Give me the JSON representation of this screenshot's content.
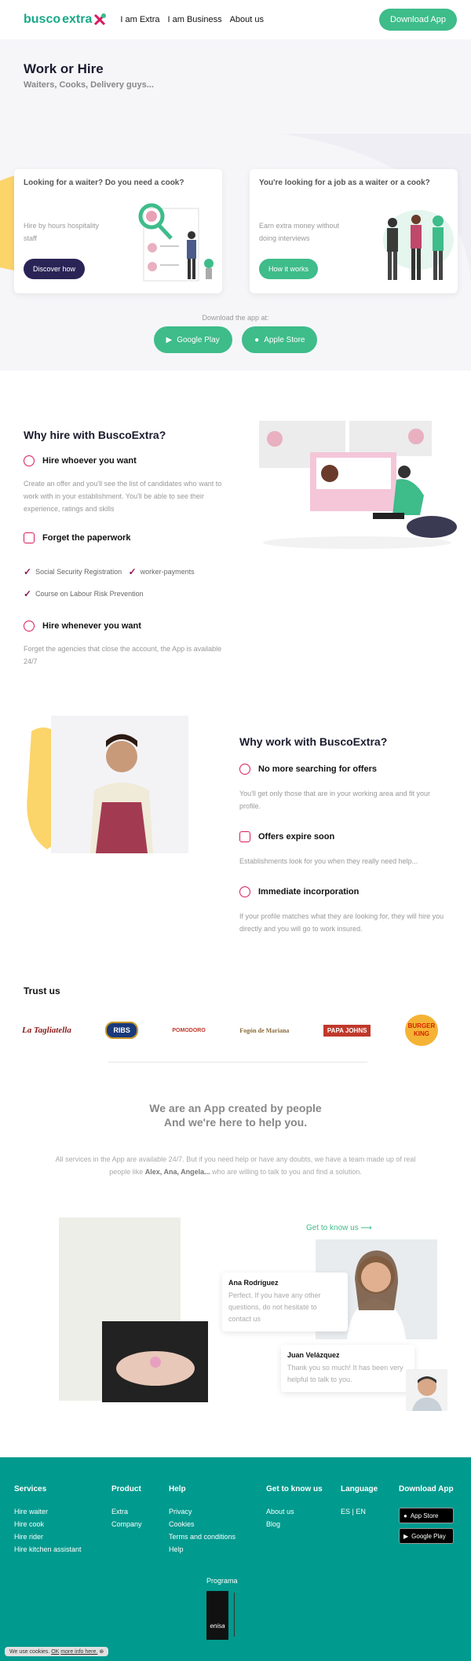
{
  "nav": {
    "logo_part1": "busco",
    "logo_part2": "extra",
    "links": [
      "I am Extra",
      "I am Business",
      "About us"
    ],
    "cta": "Download App"
  },
  "hero": {
    "title": "Work or Hire",
    "subtitle": "Waiters, Cooks, Delivery guys...",
    "card_hire": {
      "title": "Looking for a waiter? Do you need a cook?",
      "desc": "Hire by hours hospitality staff",
      "button": "Discover how"
    },
    "card_job": {
      "title": "You're looking for a job as a waiter or a cook?",
      "desc": "Earn extra money without doing interviews",
      "button": "How it works"
    }
  },
  "download": {
    "label": "Download the app at:",
    "google": "Google Play",
    "apple": "Apple Store"
  },
  "hire": {
    "title": "Why hire with BuscoExtra?",
    "f1_title": "Hire whoever you want",
    "f1_desc": "Create an offer and you'll see the list of candidates who want to work with in your establishment. You'll be able to see their experience, ratings and skills",
    "f2_title": "Forget the paperwork",
    "checks": [
      "Social Security Registration",
      "worker-payments",
      "Course on Labour Risk Prevention"
    ],
    "f3_title": "Hire whenever you want",
    "f3_desc": "Forget the agencies that close the account, the App is available 24/7"
  },
  "work": {
    "title": "Why work with BuscoExtra?",
    "f1_title": "No more searching for offers",
    "f1_desc": "You'll get only those that are in your working area and fit your profile.",
    "f2_title": "Offers expire soon",
    "f2_desc": "Establishments look for you when they really need help...",
    "f3_title": "Immediate incorporation",
    "f3_desc": "If your profile matches what they are looking for, they will hire you directly and you will go to work insured."
  },
  "trust": {
    "title": "Trust us",
    "logos": [
      "La Tagliatella",
      "RIBS",
      "POMODORO",
      "Fogón de Mariana",
      "PAPA JOHNS",
      "BURGER KING"
    ]
  },
  "help": {
    "title1": "We are an App created by people",
    "title2": "And we're here to help you.",
    "p1": "All services in the App are available 24/7. But if you need help or have any doubts, we have a team made up of real people like ",
    "names": "Alex, Ana, Angela...",
    "p2": " who are willing to talk to you and find a solution."
  },
  "team": {
    "link": "Get to know us",
    "chat1_name": "Ana Rodríguez",
    "chat1_msg": "Perfect. If you have any other questions, do not hesitate to contact us",
    "chat2_name": "Juan Velázquez",
    "chat2_msg": "Thank you so much! It has been very helpful to talk to you."
  },
  "footer": {
    "services": {
      "title": "Services",
      "items": [
        "Hire waiter",
        "Hire cook",
        "Hire rider",
        "Hire kitchen assistant"
      ]
    },
    "product": {
      "title": "Product",
      "items": [
        "Extra",
        "Company"
      ]
    },
    "help": {
      "title": "Help",
      "items": [
        "Privacy",
        "Cookies",
        "Terms and conditions",
        "Help"
      ]
    },
    "know": {
      "title": "Get to know us",
      "items": [
        "About us",
        "Blog"
      ]
    },
    "language": {
      "title": "Language",
      "es": "ES",
      "en": "EN"
    },
    "download": {
      "title": "Download App",
      "app_store": "App Store",
      "google_play": "Google Play"
    },
    "programa": "Programa",
    "enisa": "enisa"
  },
  "cookie": {
    "text": "We use cookies.",
    "ok": "OK",
    "more": "more info here."
  },
  "colors": {
    "brand": "#3ebc8a",
    "dark": "#2a2456",
    "accent": "#d81b60",
    "footer": "#009a8e"
  }
}
